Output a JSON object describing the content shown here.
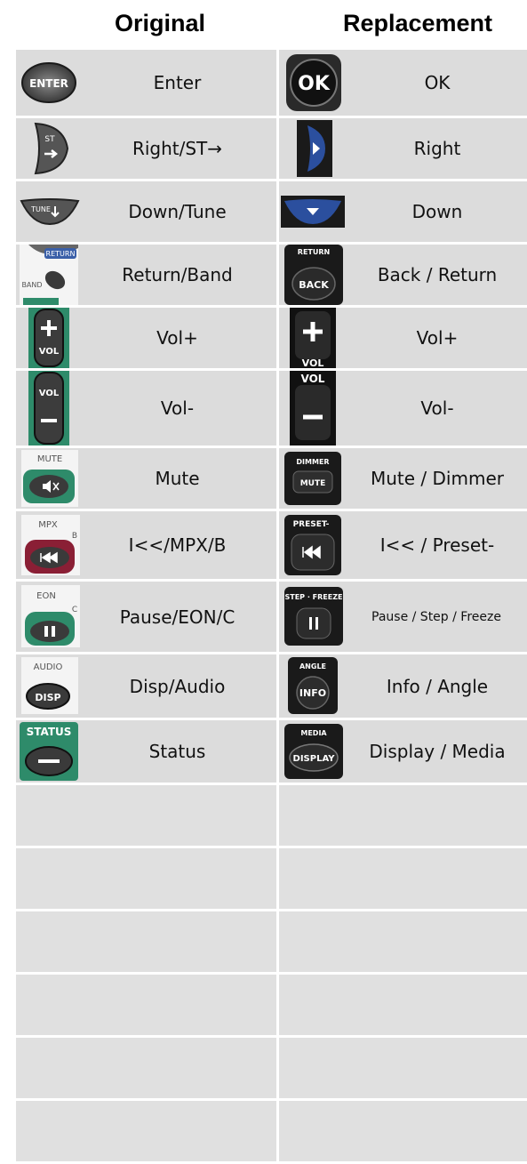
{
  "headers": {
    "original": "Original",
    "replacement": "Replacement"
  },
  "rows": [
    {
      "original": "Enter",
      "replacement": "OK",
      "orig_icon": "enter-button-icon",
      "repl_icon": "ok-button-icon"
    },
    {
      "original": "Right/ST→",
      "replacement": "Right",
      "orig_icon": "right-st-button-icon",
      "repl_icon": "right-arrow-button-icon"
    },
    {
      "original": "Down/Tune",
      "replacement": "Down",
      "orig_icon": "down-tune-button-icon",
      "repl_icon": "down-arrow-button-icon"
    },
    {
      "original": "Return/Band",
      "replacement": "Back / Return",
      "orig_icon": "return-band-button-icon",
      "repl_icon": "back-return-button-icon"
    },
    {
      "original": "Vol+",
      "replacement": "Vol+",
      "orig_icon": "vol-plus-button-icon",
      "repl_icon": "vol-plus-button-icon"
    },
    {
      "original": "Vol-",
      "replacement": "Vol-",
      "orig_icon": "vol-minus-button-icon",
      "repl_icon": "vol-minus-button-icon"
    },
    {
      "original": "Mute",
      "replacement": "Mute / Dimmer",
      "orig_icon": "mute-button-icon",
      "repl_icon": "mute-dimmer-button-icon"
    },
    {
      "original": "I<</MPX/B",
      "replacement": "I<< / Preset-",
      "orig_icon": "prev-mpx-button-icon",
      "repl_icon": "prev-preset-button-icon"
    },
    {
      "original": "Pause/EON/C",
      "replacement": "Pause / Step / Freeze",
      "orig_icon": "pause-eon-button-icon",
      "repl_icon": "pause-step-freeze-button-icon"
    },
    {
      "original": "Disp/Audio",
      "replacement": "Info / Angle",
      "orig_icon": "disp-audio-button-icon",
      "repl_icon": "info-angle-button-icon"
    },
    {
      "original": "Status",
      "replacement": "Display / Media",
      "orig_icon": "status-button-icon",
      "repl_icon": "display-media-button-icon"
    }
  ],
  "icon_text": {
    "enter": "ENTER",
    "ok": "OK",
    "st": "ST",
    "tune": "TUNE",
    "return": "RETURN",
    "band": "BAND",
    "back": "BACK",
    "vol": "VOL",
    "mute": "MUTE",
    "dimmer": "DIMMER",
    "mpx": "MPX",
    "b": "B",
    "preset": "PRESET-",
    "eon": "EON",
    "c": "C",
    "step_freeze": "STEP · FREEZE",
    "audio": "AUDIO",
    "disp": "DISP",
    "angle": "ANGLE",
    "info": "INFO",
    "status": "STATUS",
    "media": "MEDIA",
    "display": "DISPLAY"
  },
  "colors": {
    "cell_bg": "#dcdcdc",
    "green": "#2e8b6a",
    "dark_button": "#1c1c1c",
    "blue_button": "#2b4f9e",
    "maroon": "#8a1f35"
  }
}
